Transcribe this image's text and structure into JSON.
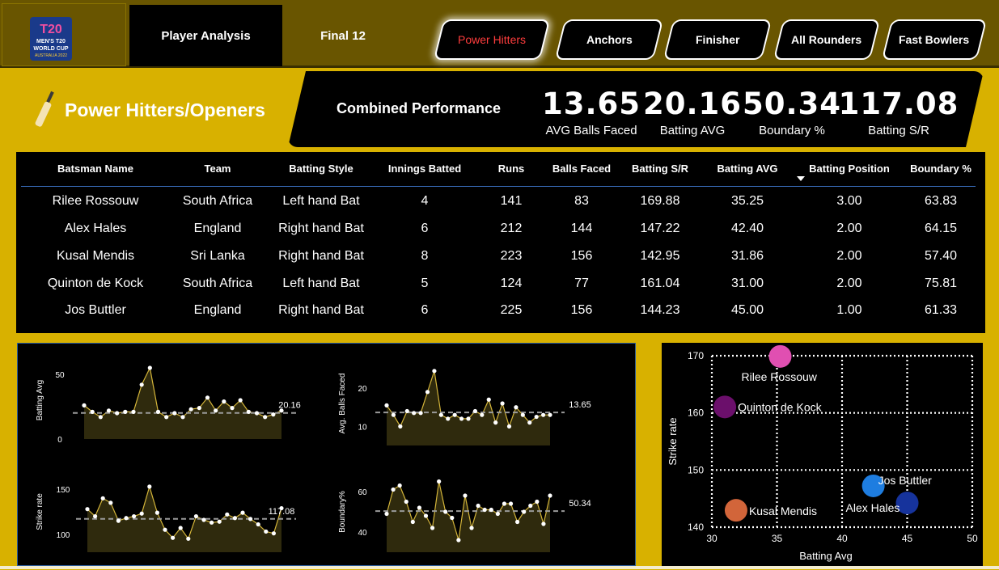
{
  "logo": {
    "alt_text": "T20 MEN'S T20 WORLD CUP AUSTRALIA 2022"
  },
  "nav": {
    "tabs": [
      {
        "label": "Player Analysis",
        "active": true
      },
      {
        "label": "Final 12",
        "active": false
      }
    ],
    "categories": [
      {
        "label": "Power Hitters",
        "selected": true
      },
      {
        "label": "Anchors",
        "selected": false
      },
      {
        "label": "Finisher",
        "selected": false
      },
      {
        "label": "All Rounders",
        "selected": false
      },
      {
        "label": "Fast Bowlers",
        "selected": false
      }
    ]
  },
  "page": {
    "title": "Power Hitters/Openers",
    "icon": "cricket-bat-icon"
  },
  "kpis": {
    "label": "Combined Performance",
    "items": [
      {
        "value": "13.65",
        "label": "AVG Balls Faced"
      },
      {
        "value": "20.16",
        "label": "Batting AVG"
      },
      {
        "value": "50.34",
        "label": "Boundary %"
      },
      {
        "value": "117.08",
        "label": "Batting S/R"
      }
    ]
  },
  "table": {
    "columns": [
      "Batsman Name",
      "Team",
      "Batting Style",
      "Innings Batted",
      "Runs",
      "Balls Faced",
      "Batting S/R",
      "Batting AVG",
      "Batting Position",
      "Boundary %"
    ],
    "sorted_column": "Batting Position",
    "rows": [
      [
        "Rilee Rossouw",
        "South Africa",
        "Left hand Bat",
        "4",
        "141",
        "83",
        "169.88",
        "35.25",
        "3.00",
        "63.83"
      ],
      [
        "Alex Hales",
        "England",
        "Right hand Bat",
        "6",
        "212",
        "144",
        "147.22",
        "42.40",
        "2.00",
        "64.15"
      ],
      [
        "Kusal Mendis",
        "Sri Lanka",
        "Right hand Bat",
        "8",
        "223",
        "156",
        "142.95",
        "31.86",
        "2.00",
        "57.40"
      ],
      [
        "Quinton de Kock",
        "South Africa",
        "Left hand Bat",
        "5",
        "124",
        "77",
        "161.04",
        "31.00",
        "2.00",
        "75.81"
      ],
      [
        "Jos Buttler",
        "England",
        "Right hand Bat",
        "6",
        "225",
        "156",
        "144.23",
        "45.00",
        "1.00",
        "61.33"
      ]
    ]
  },
  "colors": {
    "accent": "#d8b100",
    "header_bg": "#695500",
    "panel": "#000000",
    "spark_line": "#d4b53a",
    "spark_fill": "#2f2a0d",
    "selected_text": "#ff3d3d"
  },
  "chart_data": [
    {
      "type": "area",
      "ylabel": "Batting Avg",
      "ticks": [
        0,
        50
      ],
      "ylim": [
        0,
        60
      ],
      "reference_line": 20.16,
      "reference_label": "20.16",
      "values": [
        26,
        21,
        17,
        22,
        20,
        21,
        21,
        42,
        55,
        21,
        17,
        20,
        17,
        23,
        24,
        32,
        22,
        29,
        24,
        30,
        21,
        20,
        17,
        19,
        22
      ]
    },
    {
      "type": "area",
      "ylabel": "Avg. Balls Faced",
      "ticks": [
        10,
        20
      ],
      "ylim": [
        5,
        27
      ],
      "reference_line": 13.65,
      "reference_label": "13.65",
      "values": [
        15.5,
        13,
        10,
        14,
        13.5,
        13.5,
        19,
        24.5,
        13,
        12,
        13,
        12,
        12,
        14,
        13,
        17,
        11,
        16,
        10,
        15,
        13,
        11,
        12.5,
        13,
        13
      ]
    },
    {
      "type": "area",
      "ylabel": "Strike rate",
      "ticks": [
        100,
        150
      ],
      "ylim": [
        80,
        170
      ],
      "reference_line": 117.08,
      "reference_label": "117.08",
      "values": [
        128,
        120,
        140,
        135,
        115,
        118,
        120,
        123,
        153,
        124,
        105,
        96,
        107,
        95,
        120,
        116,
        113,
        114,
        122,
        118,
        124,
        117,
        111,
        103,
        101,
        129
      ]
    },
    {
      "type": "area",
      "ylabel": "Boundary%",
      "ticks": [
        40,
        60
      ],
      "ylim": [
        30,
        70
      ],
      "reference_line": 50.34,
      "reference_label": "50.34",
      "values": [
        49,
        61,
        63,
        55,
        45,
        52,
        48,
        42,
        65,
        50,
        47,
        36,
        58,
        42,
        53,
        51,
        51,
        49,
        54,
        54,
        45,
        50,
        53,
        55,
        44,
        58
      ]
    },
    {
      "type": "scatter",
      "xlabel": "Batting Avg",
      "ylabel": "Strike rate",
      "xlim": [
        30,
        50
      ],
      "ylim": [
        140,
        170
      ],
      "xticks": [
        30,
        35,
        40,
        45,
        50
      ],
      "yticks": [
        140,
        150,
        160,
        170
      ],
      "grid": true,
      "points": [
        {
          "name": "Rilee Rossouw",
          "x": 35.25,
          "y": 169.88,
          "color": "#e04fb1"
        },
        {
          "name": "Quinton de Kock",
          "x": 31.0,
          "y": 161.04,
          "color": "#6b0f6b"
        },
        {
          "name": "Jos Buttler",
          "x": 42.4,
          "y": 147.22,
          "color": "#1e7de0"
        },
        {
          "name": "Alex Hales",
          "x": 45.0,
          "y": 144.23,
          "color": "#16339c"
        },
        {
          "name": "Kusal Mendis",
          "x": 31.86,
          "y": 142.95,
          "color": "#d2653a"
        }
      ]
    }
  ]
}
